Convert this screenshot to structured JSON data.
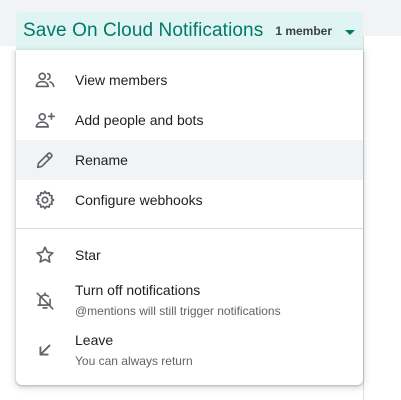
{
  "header": {
    "room_title": "Save On Cloud Notifications",
    "member_count": "1 member"
  },
  "menu": {
    "view_members": "View members",
    "add_people": "Add people and bots",
    "rename": "Rename",
    "configure_webhooks": "Configure webhooks",
    "star": "Star",
    "turn_off_notifications": "Turn off notifications",
    "turn_off_notifications_sub": "@mentions will still trigger notifications",
    "leave": "Leave",
    "leave_sub": "You can always return"
  },
  "icons": {
    "view_members": "people-icon",
    "add_people": "person-add-icon",
    "rename": "pencil-icon",
    "configure_webhooks": "gear-icon",
    "star": "star-icon",
    "turn_off_notifications": "bell-off-icon",
    "leave": "arrow-down-left-icon",
    "dropdown": "caret-down-icon"
  },
  "colors": {
    "accent": "#00796b",
    "header_bg": "#e0f5f3",
    "hover_bg": "#f1f3f4",
    "icon": "#5f6368"
  }
}
